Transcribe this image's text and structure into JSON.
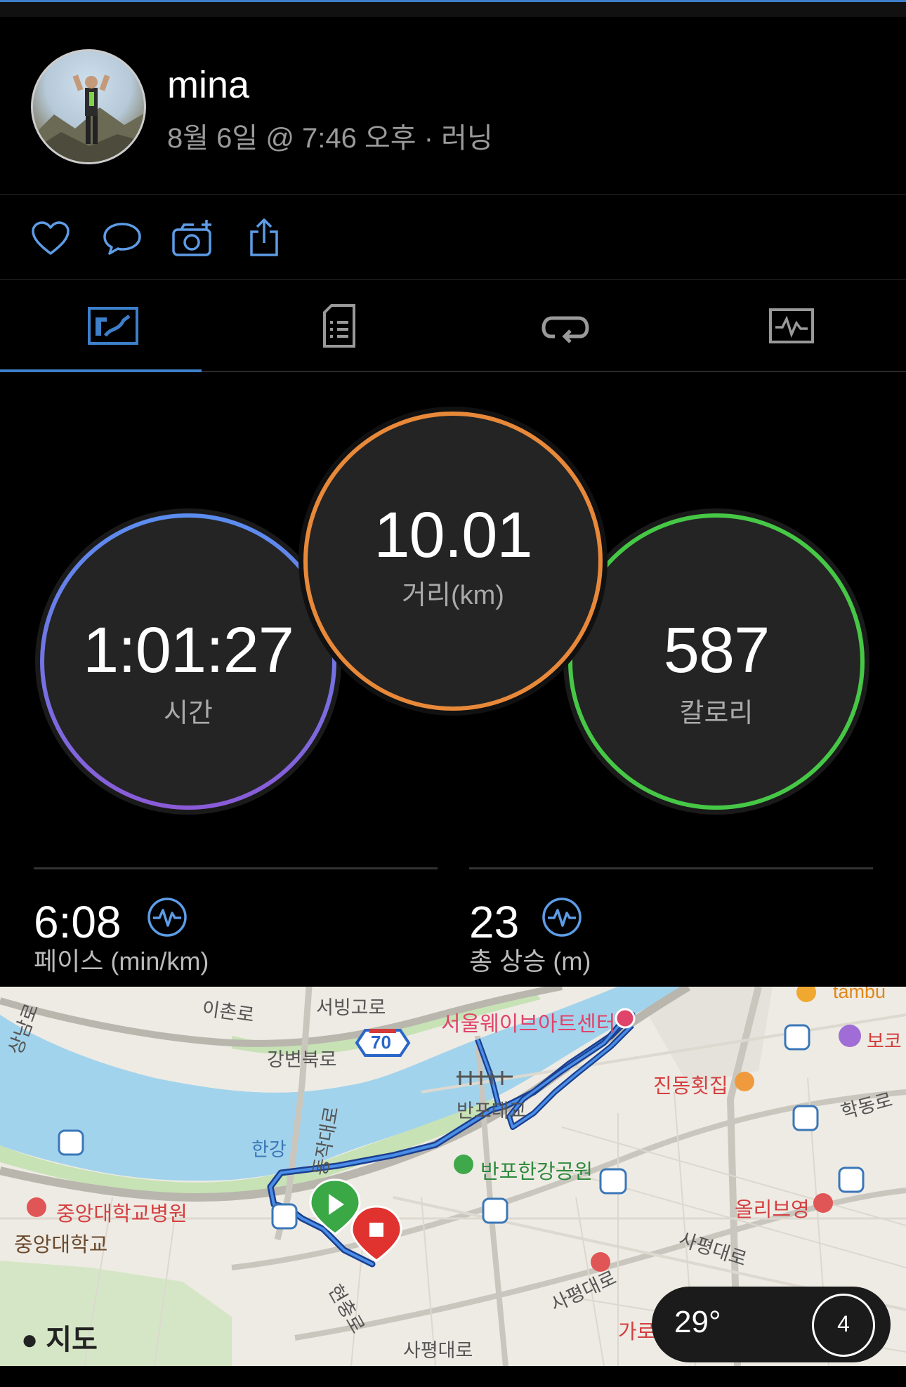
{
  "header": {
    "user_name": "mina",
    "activity_meta": "8월 6일 @ 7:46 오후 · 러닝"
  },
  "actions": [
    {
      "icon": "heart-icon"
    },
    {
      "icon": "comment-icon"
    },
    {
      "icon": "add-photo-icon"
    },
    {
      "icon": "share-icon"
    }
  ],
  "tabs": [
    {
      "icon": "overview-map-icon",
      "active": true
    },
    {
      "icon": "details-list-icon",
      "active": false
    },
    {
      "icon": "laps-loop-icon",
      "active": false
    },
    {
      "icon": "charts-icon",
      "active": false
    }
  ],
  "stats": {
    "time": {
      "value": "1:01:27",
      "label": "시간"
    },
    "distance": {
      "value": "10.01",
      "label": "거리(km)"
    },
    "calories": {
      "value": "587",
      "label": "칼로리"
    },
    "pace": {
      "value": "6:08",
      "label": "페이스 (min/km)"
    },
    "elevation": {
      "value": "23",
      "label": "총 상승 (m)"
    }
  },
  "colors": {
    "accent": "#3d7fc9",
    "time_ring_start": "#5b8def",
    "time_ring_end": "#8a5bd8",
    "distance_ring": "#e8893a",
    "calories_ring": "#46c846"
  },
  "map": {
    "labels": {
      "ichon_ro": "이촌로",
      "seobinggo_ro": "서빙고로",
      "gangbyeonbuk_ro": "강변북로",
      "highway_no": "70",
      "wave_art_center": "서울웨이브아트센터",
      "banpo_bridge": "반포대교",
      "jindong": "진동횟집",
      "hakdong_ro": "학동로",
      "bogo": "보코",
      "tambu": "tambu",
      "hangang": "한강",
      "dongjak_daero": "동작대로",
      "banpo_park": "반포한강공원",
      "chungang_hospital": "중앙대학교병원",
      "chungang_univ": "중앙대학교",
      "olive_young": "올리브영",
      "sapyeong_daero_1": "사평대로",
      "sapyeong_daero_2": "사평대로",
      "sapyeong_daero_3": "사평대로",
      "hyeonchung_ro": "현충로",
      "garo": "가로",
      "gangnam_ro": "상남로"
    },
    "attribution": "지도",
    "weather": {
      "temp": "29°",
      "aqi": "4"
    }
  }
}
